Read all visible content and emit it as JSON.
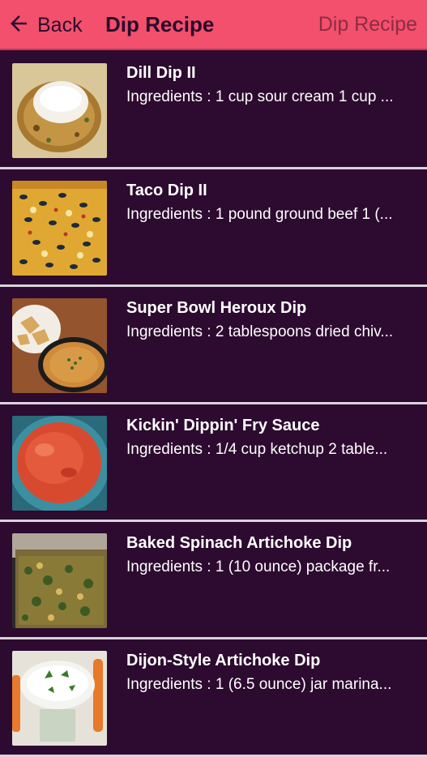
{
  "header": {
    "back_label": "Back",
    "title": "Dip Recipe",
    "subtitle": "Dip Recipe",
    "icon": "arrow-left-icon",
    "color": "#f2506d"
  },
  "recipes": [
    {
      "title": "Dill Dip II",
      "description": "Ingredients : 1 cup sour cream 1 cup ..."
    },
    {
      "title": "Taco Dip II",
      "description": "Ingredients : 1 pound ground beef 1 (..."
    },
    {
      "title": "Super Bowl Heroux Dip",
      "description": "Ingredients : 2 tablespoons dried chiv..."
    },
    {
      "title": "Kickin' Dippin' Fry Sauce",
      "description": "Ingredients : 1/4 cup ketchup 2 table..."
    },
    {
      "title": "Baked Spinach Artichoke Dip",
      "description": "Ingredients : 1 (10 ounce) package fr..."
    },
    {
      "title": "Dijon-Style Artichoke Dip",
      "description": "Ingredients : 1 (6.5 ounce) jar marina..."
    }
  ],
  "colors": {
    "background": "#2d0a30",
    "divider": "#d9d4d9",
    "text": "#ffffff"
  }
}
